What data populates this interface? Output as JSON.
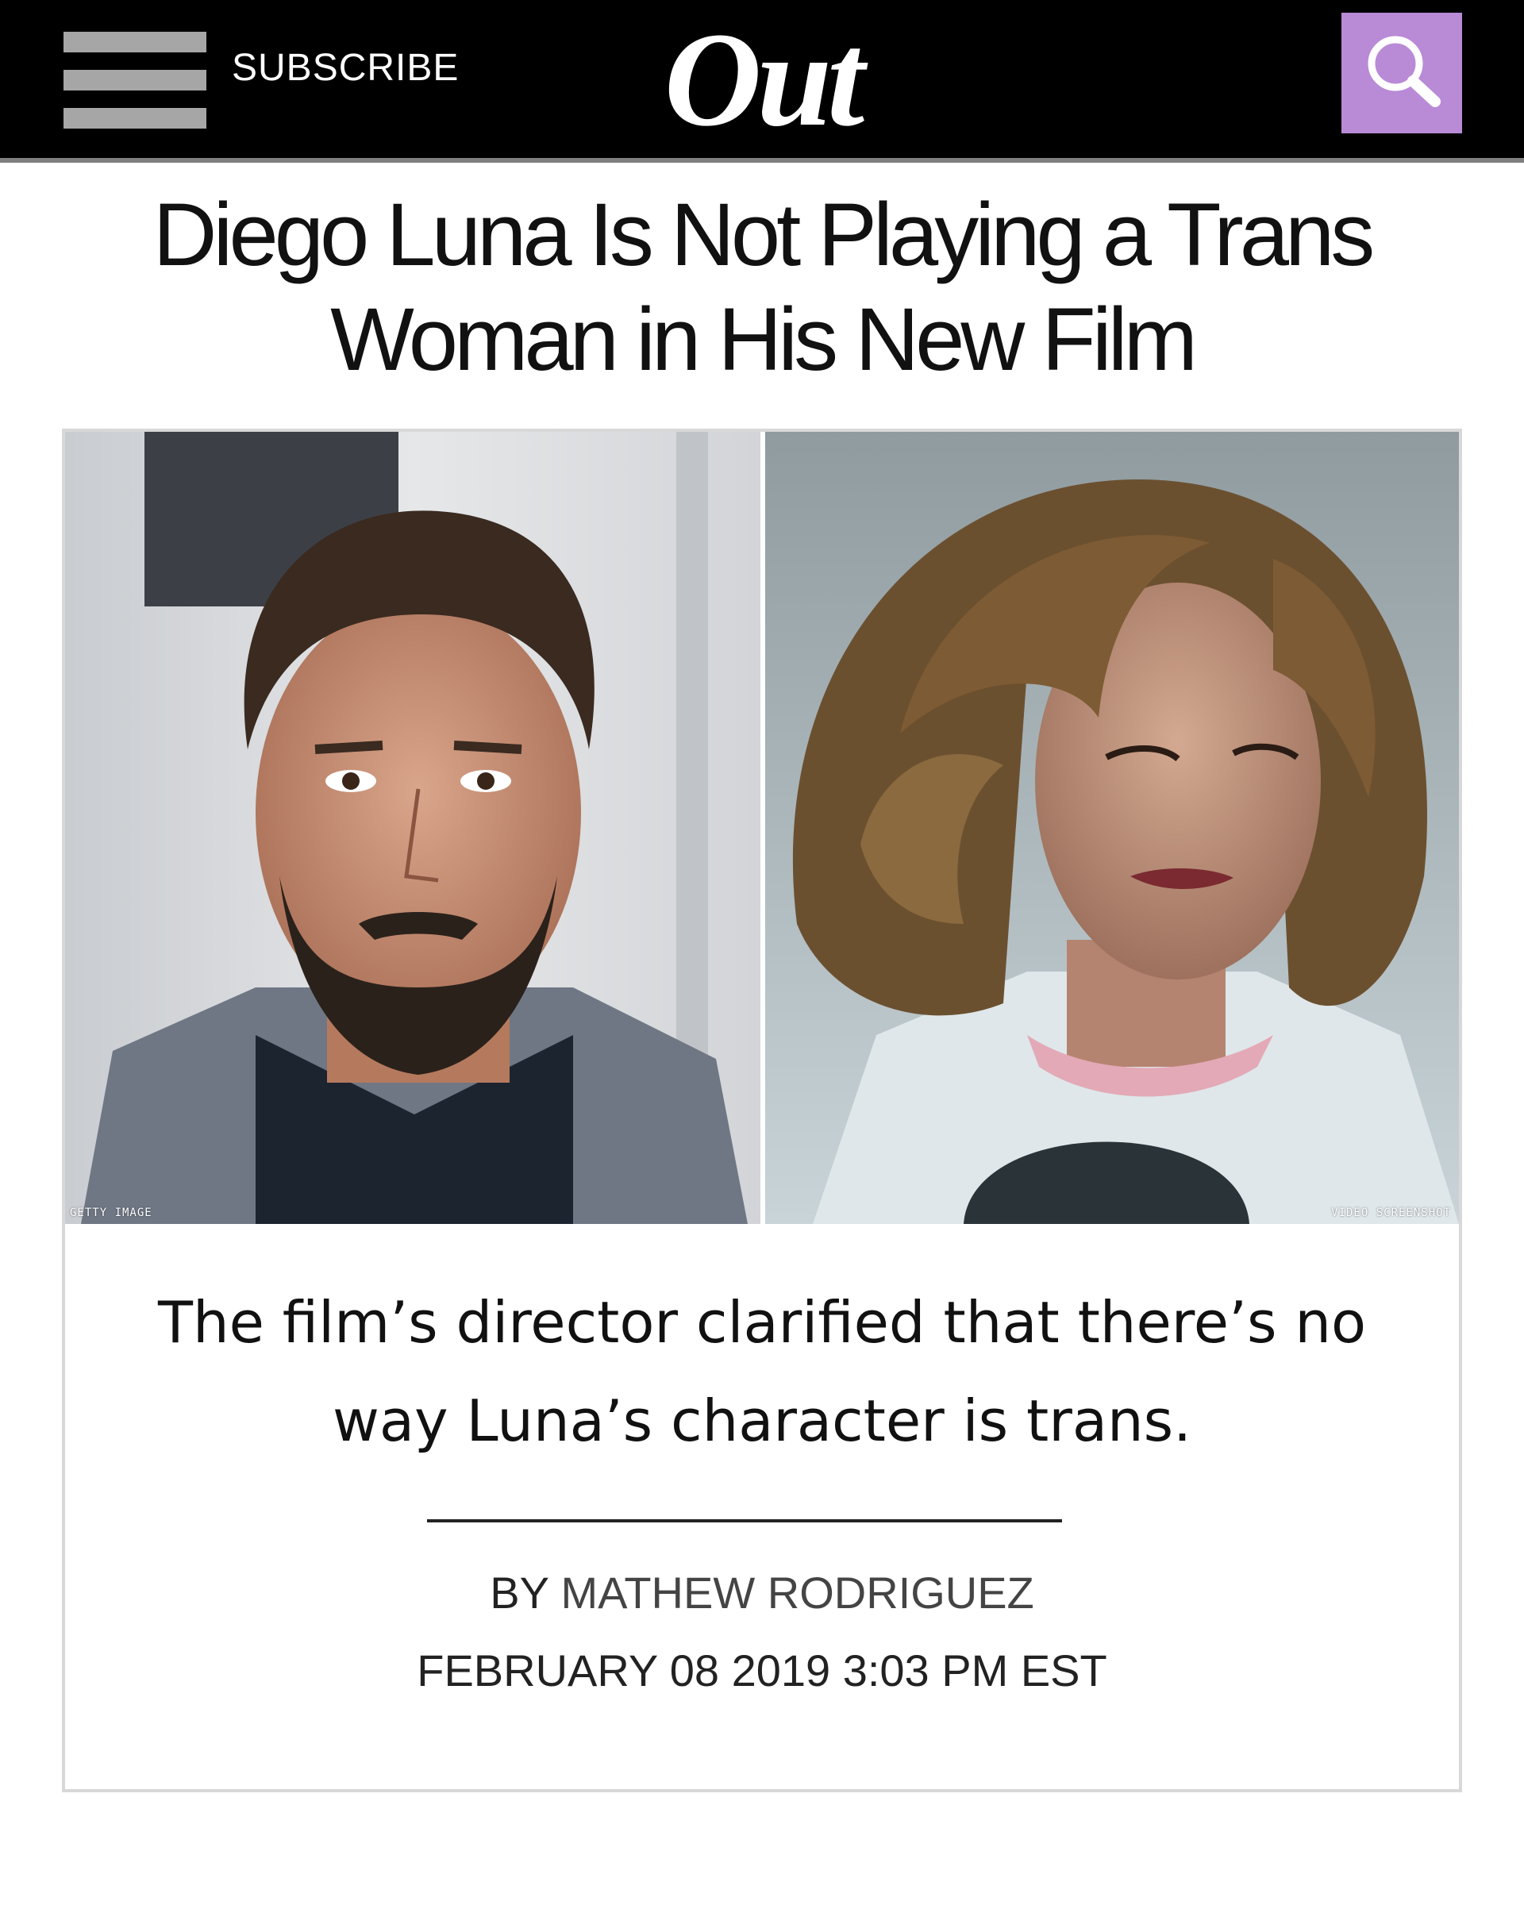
{
  "header": {
    "subscribe_label": "SUBSCRIBE",
    "logo_text": "Out",
    "search_icon": "search-icon",
    "menu_icon": "hamburger-menu-icon",
    "accent_color": "#b98ad6"
  },
  "article": {
    "headline": "Diego Luna Is Not Playing a Trans Woman in His New Film",
    "images": [
      {
        "credit": "GETTY IMAGE"
      },
      {
        "credit": "VIDEO SCREENSHOT"
      }
    ],
    "dek": "The film’s director clarified that there’s no way Luna’s character is trans.",
    "byline_prefix": "BY",
    "author": "MATHEW RODRIGUEZ",
    "date": "FEBRUARY 08 2019 3:03 PM EST"
  }
}
